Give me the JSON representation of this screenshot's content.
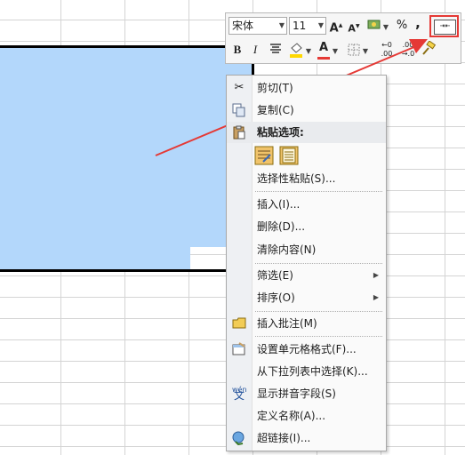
{
  "toolbar": {
    "font_name": "宋体",
    "font_size": "11",
    "grow_font": "A",
    "shrink_font": "A",
    "percent": "%",
    "comma": ",",
    "bold": "B",
    "italic": "I",
    "font_color": "A"
  },
  "menu": {
    "items": [
      {
        "label": "剪切(T)",
        "icon": "scissors-icon"
      },
      {
        "label": "复制(C)",
        "icon": "copy-icon"
      },
      {
        "label": "粘贴选项:",
        "icon": "clipboard-icon"
      },
      {
        "label": "选择性粘贴(S)..."
      },
      {
        "label": "插入(I)..."
      },
      {
        "label": "删除(D)..."
      },
      {
        "label": "清除内容(N)"
      },
      {
        "label": "筛选(E)"
      },
      {
        "label": "排序(O)"
      },
      {
        "label": "插入批注(M)",
        "icon": "comment-icon"
      },
      {
        "label": "设置单元格格式(F)...",
        "icon": "format-cells-icon"
      },
      {
        "label": "从下拉列表中选择(K)..."
      },
      {
        "label": "显示拼音字段(S)",
        "icon": "phonetic-icon"
      },
      {
        "label": "定义名称(A)..."
      },
      {
        "label": "超链接(I)...",
        "icon": "hyperlink-icon"
      }
    ]
  },
  "colors": {
    "selection": "#b3d7fb",
    "arrow": "#e53935",
    "font_color_bar": "#e53935",
    "highlight_bar": "#ffd800"
  }
}
